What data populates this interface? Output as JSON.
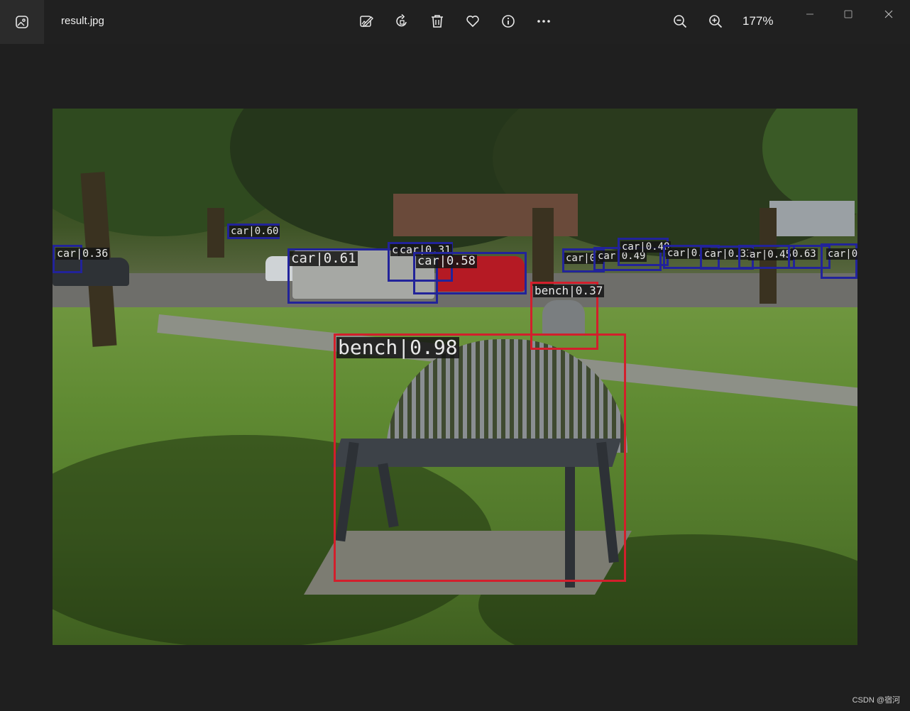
{
  "window": {
    "filename": "result.jpg",
    "zoom": "177%"
  },
  "toolbar": {
    "edit_icon": "edit-image-icon",
    "rotate_icon": "rotate-icon",
    "delete_icon": "delete-icon",
    "favorite_icon": "heart-icon",
    "info_icon": "info-icon",
    "more_icon": "more-icon",
    "zoom_out_icon": "zoom-out-icon",
    "zoom_in_icon": "zoom-in-icon"
  },
  "window_controls": [
    "minimize-icon",
    "maximize-icon",
    "close-icon"
  ],
  "detections": [
    {
      "label": "car|0.60"
    },
    {
      "label": "car|0.36"
    },
    {
      "label": "car|0.61"
    },
    {
      "label": "car|0.31"
    },
    {
      "label": "car|0.58"
    },
    {
      "label": "car|0."
    },
    {
      "label": "car|0.49"
    },
    {
      "label": "car|0.48"
    },
    {
      "label": "car|0.7"
    },
    {
      "label": "car|0.33"
    },
    {
      "label": "ar|0.45"
    },
    {
      "label": "0.63"
    },
    {
      "label": "car|0."
    },
    {
      "label": "bench|0.37"
    },
    {
      "label": "bench|0.98"
    },
    {
      "label": "c"
    }
  ],
  "colors": {
    "car_box": "#22239a",
    "bench_box": "#d21f2c"
  },
  "watermark": "CSDN @宿河"
}
